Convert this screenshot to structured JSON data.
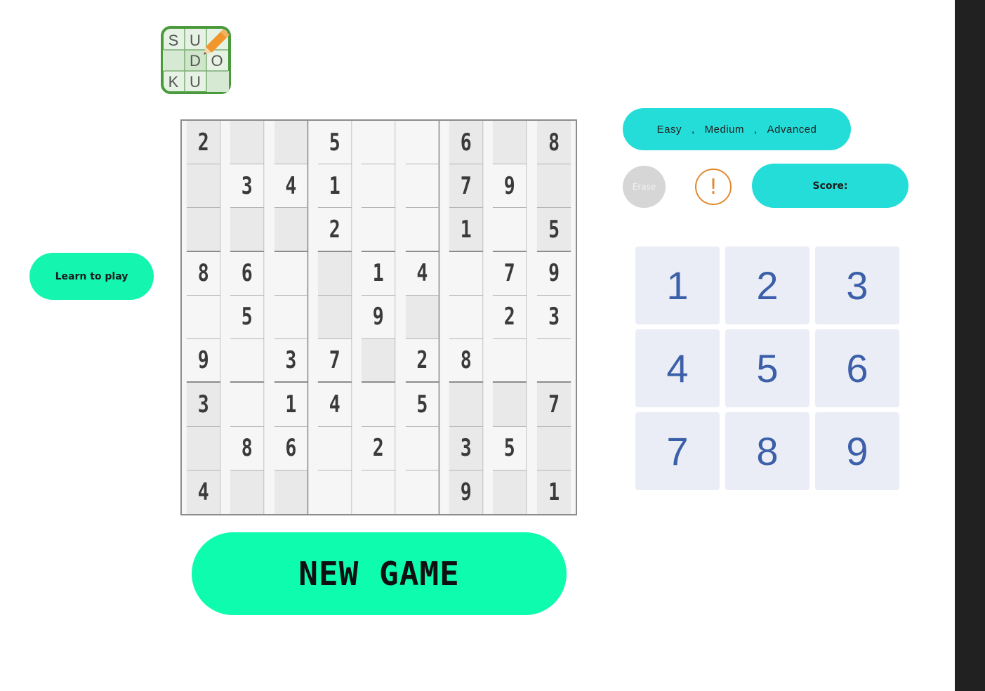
{
  "logo": {
    "letters": [
      "S",
      "U",
      "",
      "",
      "D",
      "O",
      "K",
      "U",
      ""
    ],
    "colors": {
      "border": "#4a9a3c",
      "pencil": "#f0962c"
    }
  },
  "board": {
    "cells": [
      [
        "2",
        "",
        "",
        "5",
        "",
        "",
        "6",
        "",
        "8"
      ],
      [
        "",
        "3",
        "4",
        "1",
        "",
        "",
        "7",
        "9",
        ""
      ],
      [
        "",
        "",
        "",
        "2",
        "",
        "",
        "1",
        "",
        "5"
      ],
      [
        "8",
        "6",
        "",
        "",
        "1",
        "4",
        "",
        "7",
        "9"
      ],
      [
        "",
        "5",
        "",
        "",
        "9",
        "",
        "",
        "2",
        "3"
      ],
      [
        "9",
        "",
        "3",
        "7",
        "",
        "2",
        "8",
        "",
        ""
      ],
      [
        "3",
        "",
        "1",
        "4",
        "",
        "5",
        "",
        "",
        "7"
      ],
      [
        "",
        "8",
        "6",
        "",
        "2",
        "",
        "3",
        "5",
        ""
      ],
      [
        "4",
        "",
        "",
        "",
        "",
        "",
        "9",
        "",
        "1"
      ]
    ]
  },
  "actions": {
    "new_game_label": "NEW GAME",
    "learn_label": "Learn to play",
    "erase_label": "Erase",
    "hint_label": "!",
    "score_label": "Score:"
  },
  "difficulty": {
    "options": [
      "Easy",
      "Medium",
      "Advanced"
    ],
    "separator": ","
  },
  "numpad": {
    "keys": [
      "1",
      "2",
      "3",
      "4",
      "5",
      "6",
      "7",
      "8",
      "9"
    ]
  },
  "colors": {
    "accent_green": "#0dfcae",
    "accent_cyan": "#25ddd8",
    "hint_orange": "#e08a30",
    "numpad_digit": "#3b5fa8"
  }
}
